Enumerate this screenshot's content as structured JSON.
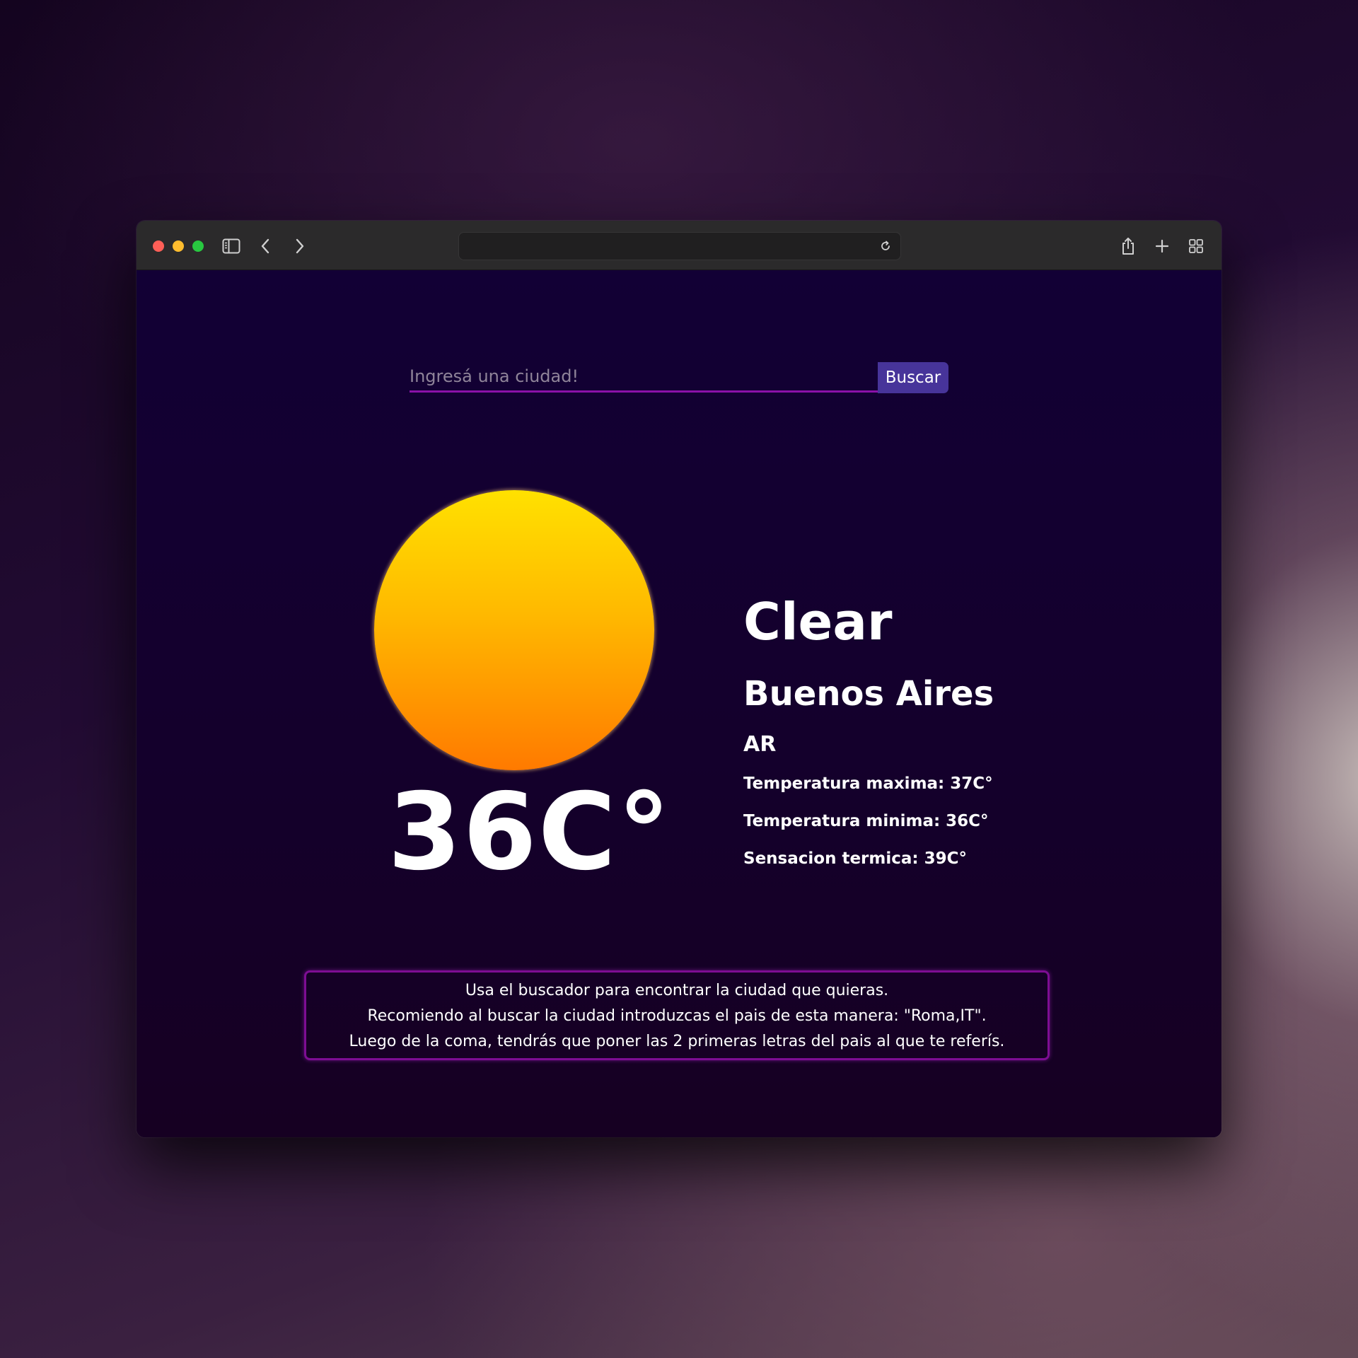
{
  "browser": {
    "url": "",
    "toolbar_icons": [
      "sidebar-icon",
      "back-icon",
      "forward-icon",
      "reload-icon",
      "share-icon",
      "new-tab-icon",
      "tab-overview-icon"
    ]
  },
  "search": {
    "placeholder": "Ingresá una ciudad!",
    "value": "",
    "button_label": "Buscar"
  },
  "weather": {
    "icon": "sun-icon",
    "temperature": "36C°",
    "condition": "Clear",
    "city": "Buenos Aires",
    "country": "AR",
    "max_temp": "Temperatura maxima: 37C°",
    "min_temp": "Temperatura minima: 36C°",
    "feels_like": "Sensacion termica: 39C°"
  },
  "notice": {
    "lines": [
      "Usa el buscador para encontrar la ciudad que quieras.",
      "Recomiendo al buscar la ciudad introduzcas el pais de esta manera: \"Roma,IT\".",
      "Luego de la coma, tendrás que poner las 2 primeras letras del pais al que te referís."
    ]
  },
  "colors": {
    "page_background": "#120035",
    "accent_purple": "#8a11a8",
    "button_background": "#47349a",
    "sun_top": "#ffe100",
    "sun_bottom": "#ff7a00",
    "text": "#ffffff"
  }
}
